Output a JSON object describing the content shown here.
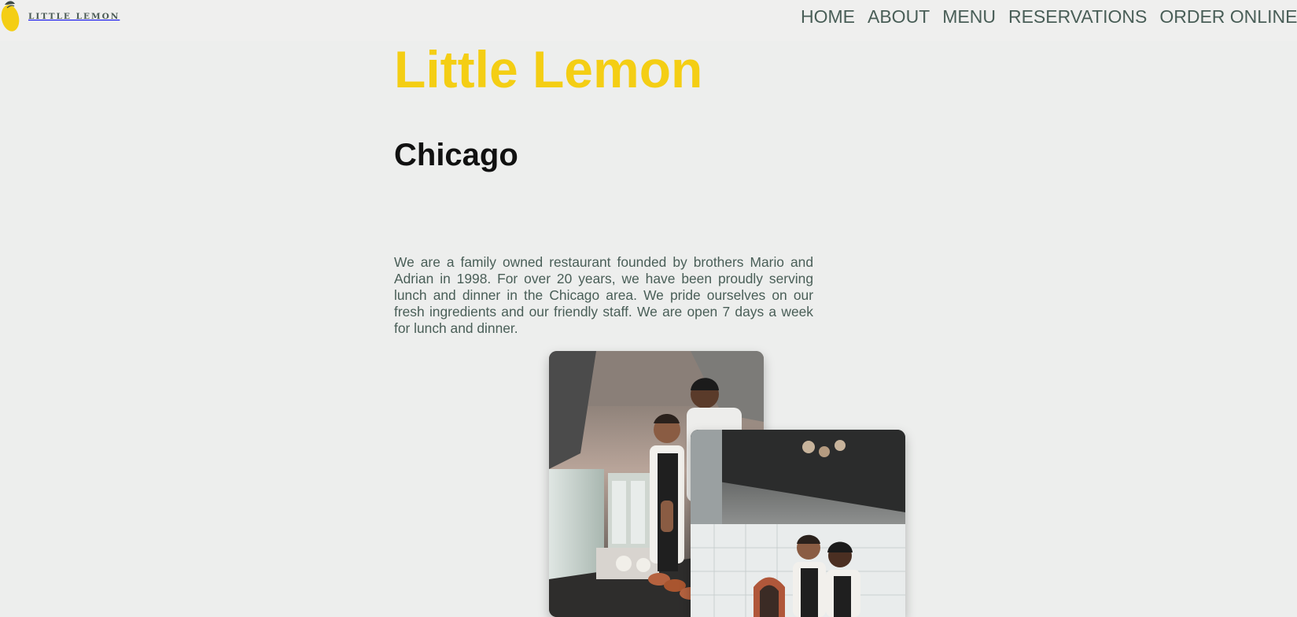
{
  "header": {
    "logo_text": "LITTLE LEMON",
    "logo_icon": "lemon-icon",
    "nav": [
      {
        "label": "HOME"
      },
      {
        "label": "ABOUT"
      },
      {
        "label": "MENU"
      },
      {
        "label": "RESERVATIONS"
      },
      {
        "label": "ORDER ONLINE"
      }
    ]
  },
  "hero": {
    "title": "Little Lemon",
    "subtitle": "Chicago",
    "description": "We are a family owned restaurant founded by brothers Mario and Adrian in 1998. For over 20 years, we have been proudly serving lunch and dinner in the Chicago area. We pride ourselves on our fresh ingredients and our friendly staff. We are open 7 days a week for lunch and dinner."
  },
  "colors": {
    "brand_yellow": "#F4CE14",
    "brand_green": "#495E57",
    "background": "#EDEEED"
  },
  "images": [
    {
      "name": "chefs-talking-photo",
      "icon": "photo-icon"
    },
    {
      "name": "chefs-smiling-photo",
      "icon": "photo-icon"
    }
  ]
}
